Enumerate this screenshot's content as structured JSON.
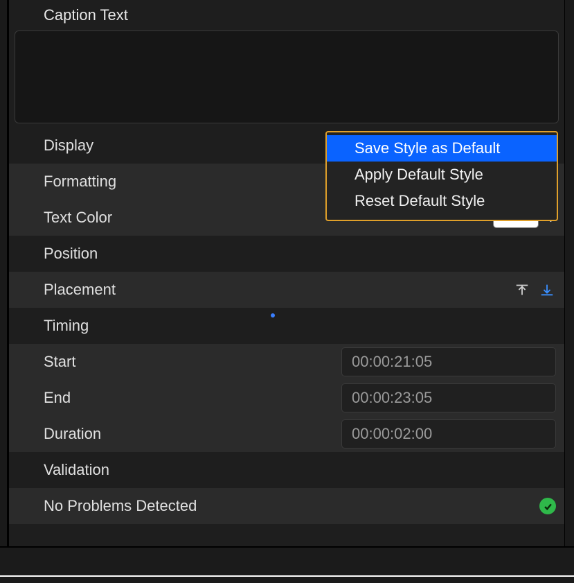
{
  "section": {
    "caption_text_label": "Caption Text",
    "display_label": "Display",
    "formatting_label": "Formatting",
    "text_color_label": "Text Color",
    "position_label": "Position",
    "placement_label": "Placement",
    "timing_label": "Timing",
    "start_label": "Start",
    "end_label": "End",
    "duration_label": "Duration",
    "validation_label": "Validation",
    "validation_status": "No Problems Detected"
  },
  "timing_values": {
    "start": "00:00:21:05",
    "end": "00:00:23:05",
    "duration": "00:00:02:00"
  },
  "text_color_value": "#ffffff",
  "popup_menu": {
    "items": [
      "Save Style as Default",
      "Apply Default Style",
      "Reset Default Style"
    ],
    "selected_index": 0
  }
}
